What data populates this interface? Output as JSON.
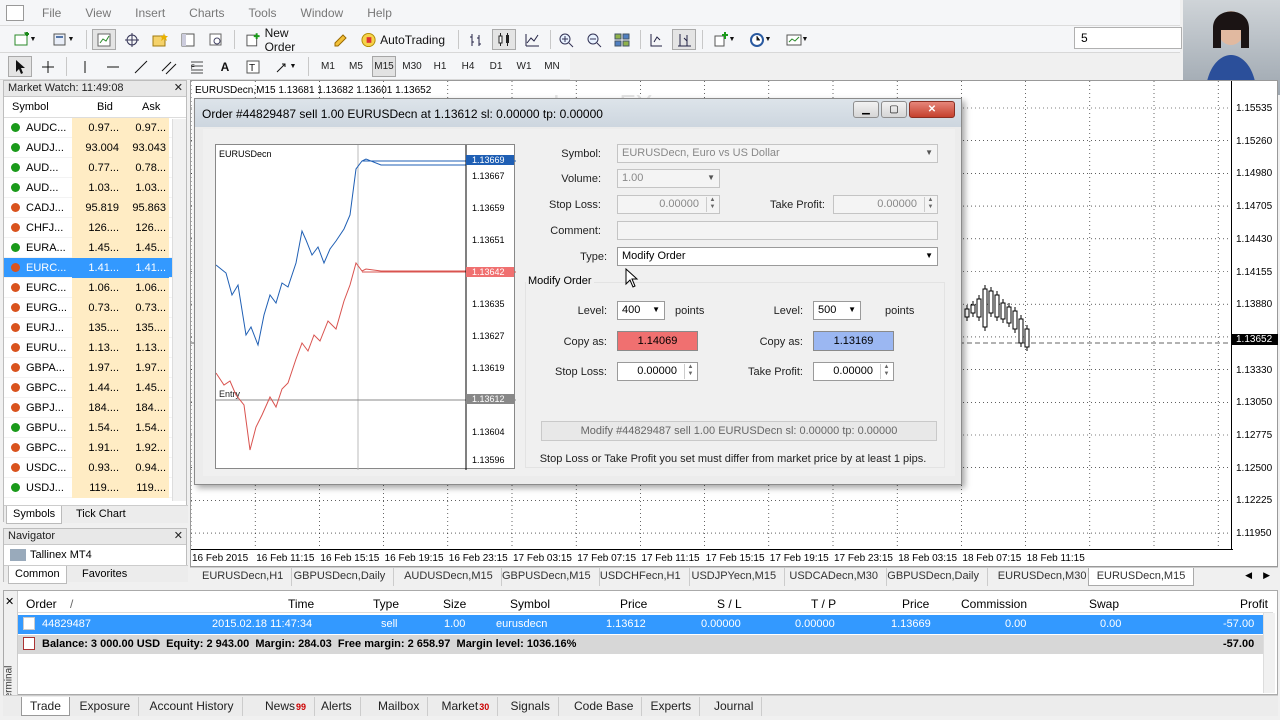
{
  "menu": [
    "File",
    "View",
    "Insert",
    "Charts",
    "Tools",
    "Window",
    "Help"
  ],
  "toolbar": {
    "new_order": "New Order",
    "autotrading": "AutoTrading",
    "search_value": "5"
  },
  "timeframes": [
    "M1",
    "M5",
    "M15",
    "M30",
    "H1",
    "H4",
    "D1",
    "W1",
    "MN"
  ],
  "active_timeframe": "M15",
  "market_watch": {
    "title": "Market Watch: 11:49:08",
    "cols": {
      "symbol": "Symbol",
      "bid": "Bid",
      "ask": "Ask"
    },
    "rows": [
      {
        "symbol": "AUDC...",
        "bid": "0.97...",
        "ask": "0.97...",
        "dir": "up"
      },
      {
        "symbol": "AUDJ...",
        "bid": "93.004",
        "ask": "93.043",
        "dir": "up"
      },
      {
        "symbol": "AUD...",
        "bid": "0.77...",
        "ask": "0.78...",
        "dir": "up"
      },
      {
        "symbol": "AUD...",
        "bid": "1.03...",
        "ask": "1.03...",
        "dir": "up"
      },
      {
        "symbol": "CADJ...",
        "bid": "95.819",
        "ask": "95.863",
        "dir": "down"
      },
      {
        "symbol": "CHFJ...",
        "bid": "126....",
        "ask": "126....",
        "dir": "down"
      },
      {
        "symbol": "EURA...",
        "bid": "1.45...",
        "ask": "1.45...",
        "dir": "up"
      },
      {
        "symbol": "EURC...",
        "bid": "1.41...",
        "ask": "1.41...",
        "dir": "down"
      },
      {
        "symbol": "EURC...",
        "bid": "1.06...",
        "ask": "1.06...",
        "dir": "down"
      },
      {
        "symbol": "EURG...",
        "bid": "0.73...",
        "ask": "0.73...",
        "dir": "down"
      },
      {
        "symbol": "EURJ...",
        "bid": "135....",
        "ask": "135....",
        "dir": "down"
      },
      {
        "symbol": "EURU...",
        "bid": "1.13...",
        "ask": "1.13...",
        "dir": "down"
      },
      {
        "symbol": "GBPA...",
        "bid": "1.97...",
        "ask": "1.97...",
        "dir": "down"
      },
      {
        "symbol": "GBPC...",
        "bid": "1.44...",
        "ask": "1.45...",
        "dir": "down"
      },
      {
        "symbol": "GBPJ...",
        "bid": "184....",
        "ask": "184....",
        "dir": "down"
      },
      {
        "symbol": "GBPU...",
        "bid": "1.54...",
        "ask": "1.54...",
        "dir": "up"
      },
      {
        "symbol": "GBPC...",
        "bid": "1.91...",
        "ask": "1.92...",
        "dir": "down"
      },
      {
        "symbol": "USDC...",
        "bid": "0.93...",
        "ask": "0.94...",
        "dir": "down"
      },
      {
        "symbol": "USDJ...",
        "bid": "119....",
        "ask": "119....",
        "dir": "up"
      }
    ],
    "selected_index": 7,
    "tabs": [
      "Symbols",
      "Tick Chart"
    ]
  },
  "navigator": {
    "title": "Navigator",
    "item": "Tallinex MT4",
    "tabs": [
      "Common",
      "Favorites"
    ]
  },
  "chart": {
    "title": "EURUSDecn,M15  1.13681  1.13682  1.13601  1.13652",
    "watermark": "LunarFX.com",
    "price_labels": [
      "1.15535",
      "1.15260",
      "1.14980",
      "1.14705",
      "1.14430",
      "1.14155",
      "1.13880",
      "1.13652",
      "1.13330",
      "1.13050",
      "1.12775",
      "1.12500",
      "1.12225",
      "1.11950"
    ],
    "current_price": "1.13652",
    "time_labels": [
      "16 Feb 2015",
      "16 Feb 11:15",
      "16 Feb 15:15",
      "16 Feb 19:15",
      "16 Feb 23:15",
      "17 Feb 03:15",
      "17 Feb 07:15",
      "17 Feb 11:15",
      "17 Feb 15:15",
      "17 Feb 19:15",
      "17 Feb 23:15",
      "18 Feb 03:15",
      "18 Feb 07:15",
      "18 Feb 11:15"
    ]
  },
  "chart_tabs": [
    "EURUSDecn,H1",
    "GBPUSDecn,Daily",
    "AUDUSDecn,M15",
    "GBPUSDecn,M15",
    "USDCHFecn,H1",
    "USDJPYecn,M15",
    "USDCADecn,M30",
    "GBPUSDecn,Daily",
    "EURUSDecn,M30",
    "EURUSDecn,M15"
  ],
  "active_chart_tab": 9,
  "dialog": {
    "title": "Order #44829487 sell 1.00 EURUSDecn at 1.13612 sl: 0.00000 tp: 0.00000",
    "mini_chart": {
      "symbol": "EURUSDecn",
      "labels": [
        "1.13667",
        "1.13659",
        "1.13651",
        "1.13643",
        "1.13635",
        "1.13627",
        "1.13619",
        "1.13612",
        "1.13604",
        "1.13596"
      ],
      "ask_tag": "1.13669",
      "bid_tag": "1.13642",
      "entry_tag": "1.13612",
      "entry_label": "Entry"
    },
    "symbol_label": "Symbol:",
    "symbol_value": "EURUSDecn, Euro vs US Dollar",
    "volume_label": "Volume:",
    "volume_value": "1.00",
    "sl_label": "Stop Loss:",
    "sl_value": "0.00000",
    "tp_label": "Take Profit:",
    "tp_value": "0.00000",
    "comment_label": "Comment:",
    "comment_value": "",
    "type_label": "Type:",
    "type_value": "Modify Order",
    "modify_group": "Modify Order",
    "left": {
      "level_label": "Level:",
      "level": "400",
      "points": "points",
      "copy_label": "Copy as:",
      "copy_value": "1.14069",
      "sl_label": "Stop Loss:",
      "sl_value": "0.00000"
    },
    "right": {
      "level_label": "Level:",
      "level": "500",
      "points": "points",
      "copy_label": "Copy as:",
      "copy_value": "1.13169",
      "tp_label": "Take Profit:",
      "tp_value": "0.00000"
    },
    "modify_button": "Modify #44829487 sell 1.00 EURUSDecn sl: 0.00000 tp: 0.00000",
    "warning": "Stop Loss or Take Profit you set must differ from market price by at least 1 pips."
  },
  "terminal": {
    "side_label": "Terminal",
    "headers": [
      "Order",
      "/",
      "Time",
      "Type",
      "Size",
      "Symbol",
      "Price",
      "S / L",
      "T / P",
      "Price",
      "Commission",
      "Swap",
      "Profit"
    ],
    "row": {
      "order": "44829487",
      "time": "2015.02.18 11:47:34",
      "type": "sell",
      "size": "1.00",
      "symbol": "eurusdecn",
      "price": "1.13612",
      "sl": "0.00000",
      "tp": "0.00000",
      "cur_price": "1.13669",
      "commission": "0.00",
      "swap": "0.00",
      "profit": "-57.00"
    },
    "balance_line": "Balance: 3 000.00 USD  Equity: 2 943.00  Margin: 284.03  Free margin: 2 658.97  Margin level: 1036.16%",
    "balance_profit": "-57.00",
    "tabs": [
      {
        "label": "Trade",
        "badge": ""
      },
      {
        "label": "Exposure",
        "badge": ""
      },
      {
        "label": "Account History",
        "badge": ""
      },
      {
        "label": "News",
        "badge": "99"
      },
      {
        "label": "Alerts",
        "badge": ""
      },
      {
        "label": "Mailbox",
        "badge": ""
      },
      {
        "label": "Market",
        "badge": "30"
      },
      {
        "label": "Signals",
        "badge": ""
      },
      {
        "label": "Code Base",
        "badge": ""
      },
      {
        "label": "Experts",
        "badge": ""
      },
      {
        "label": "Journal",
        "badge": ""
      }
    ]
  },
  "colors": {
    "selected": "#3399ff",
    "bid_bg": "#ffecc4",
    "up": "#1a9a1a",
    "down": "#d9531e",
    "copy_red": "#f07070",
    "copy_blue": "#9bb7f2"
  }
}
